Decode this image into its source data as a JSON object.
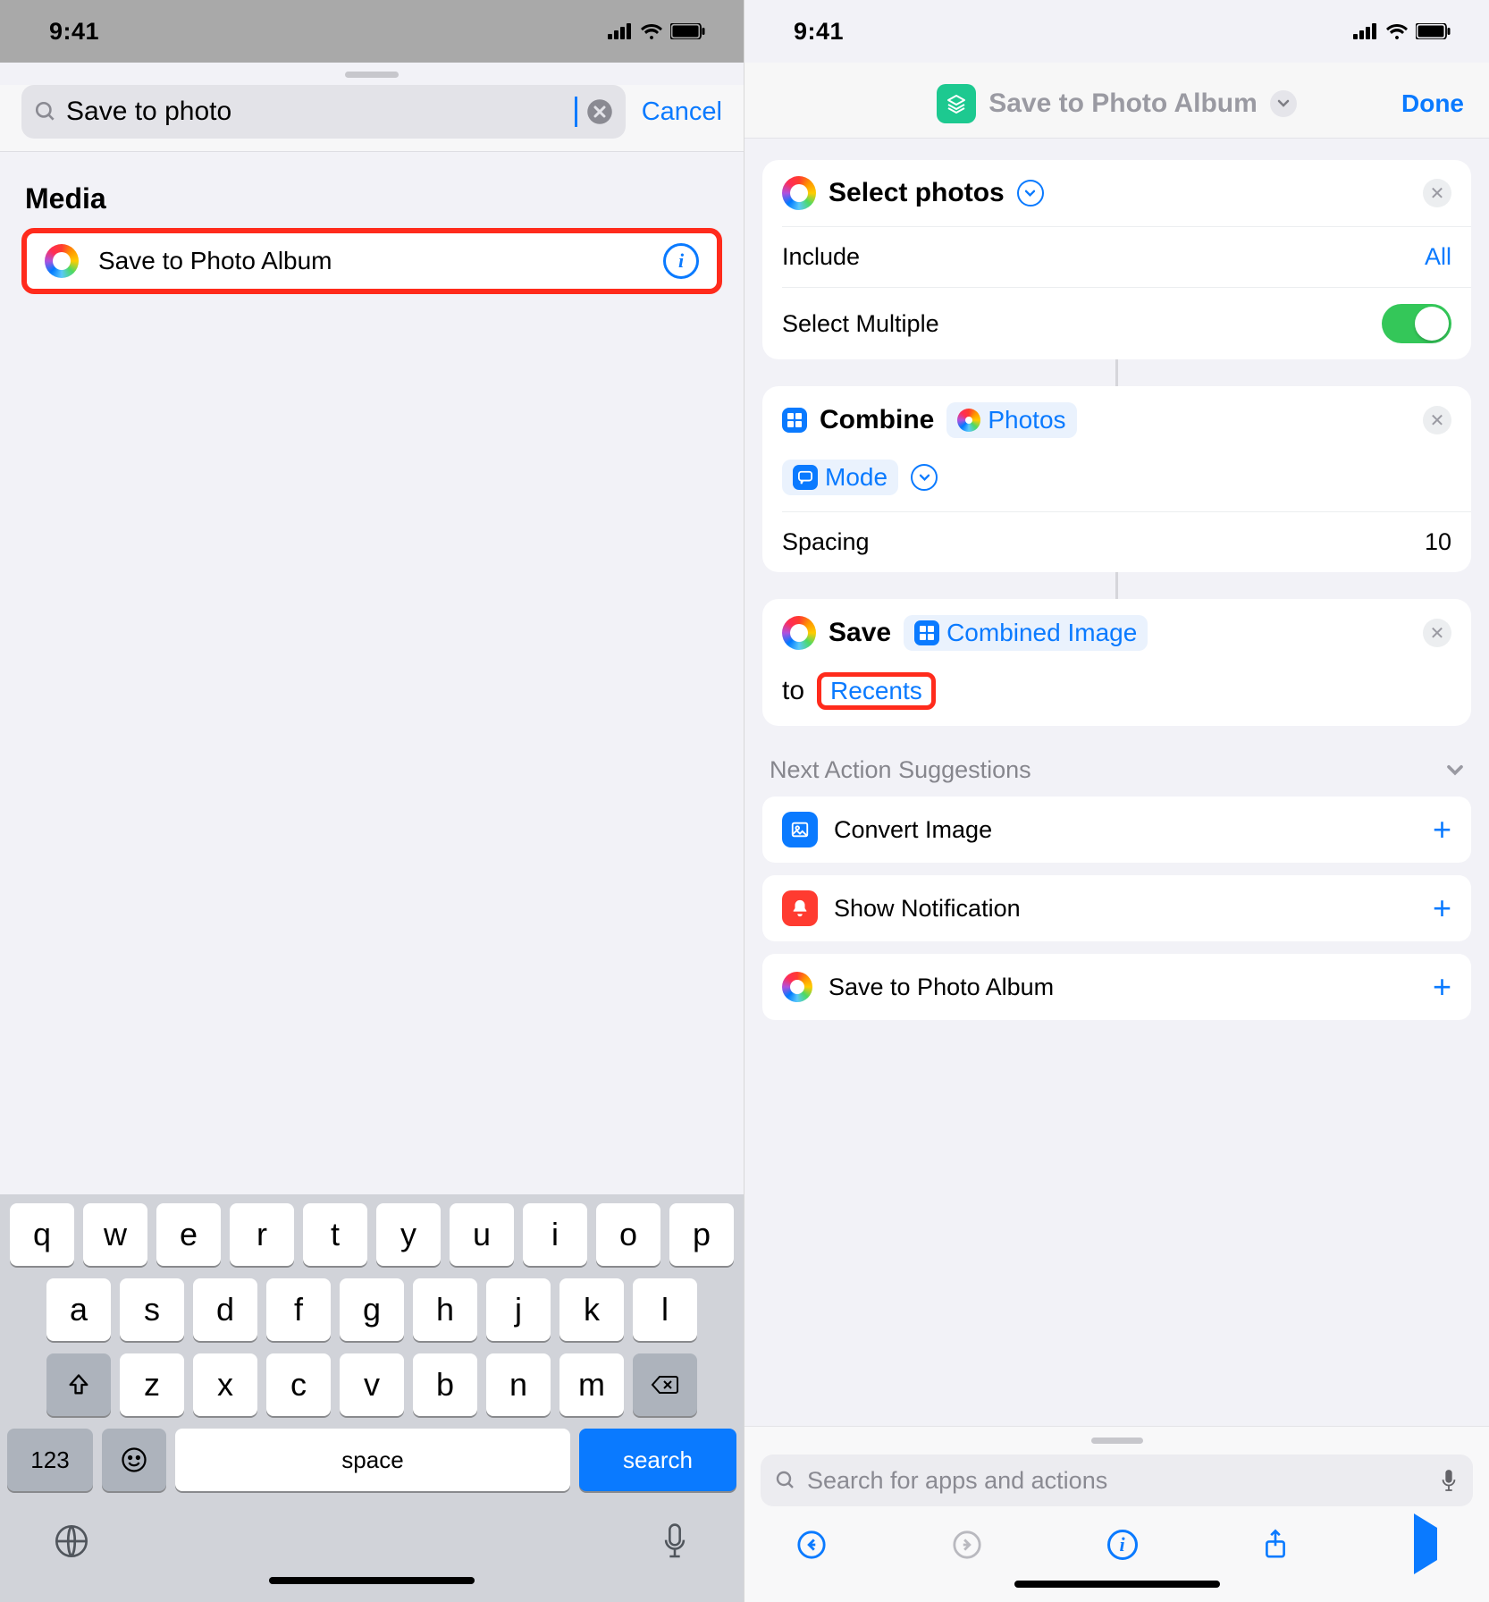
{
  "statusbar": {
    "time": "9:41"
  },
  "left": {
    "search": {
      "value": "Save to photo",
      "cancel": "Cancel"
    },
    "section_title": "Media",
    "result_label": "Save to Photo Album",
    "keyboard": {
      "row1": [
        "q",
        "w",
        "e",
        "r",
        "t",
        "y",
        "u",
        "i",
        "o",
        "p"
      ],
      "row2": [
        "a",
        "s",
        "d",
        "f",
        "g",
        "h",
        "j",
        "k",
        "l"
      ],
      "row3": [
        "z",
        "x",
        "c",
        "v",
        "b",
        "n",
        "m"
      ],
      "k123": "123",
      "space": "space",
      "search": "search"
    }
  },
  "right": {
    "title": "Save to Photo Album",
    "done": "Done",
    "card1": {
      "title": "Select photos",
      "include_label": "Include",
      "include_value": "All",
      "multiple_label": "Select Multiple"
    },
    "card2": {
      "combine": "Combine",
      "photos_chip": "Photos",
      "mode_chip": "Mode",
      "spacing_label": "Spacing",
      "spacing_value": "10"
    },
    "card3": {
      "save_word": "Save",
      "combined_chip": "Combined Image",
      "to_word": "to",
      "recents": "Recents"
    },
    "suggestions_header": "Next Action Suggestions",
    "suggestions": {
      "s1": "Convert Image",
      "s2": "Show Notification",
      "s3": "Save to Photo Album"
    },
    "bottom_search_placeholder": "Search for apps and actions"
  }
}
